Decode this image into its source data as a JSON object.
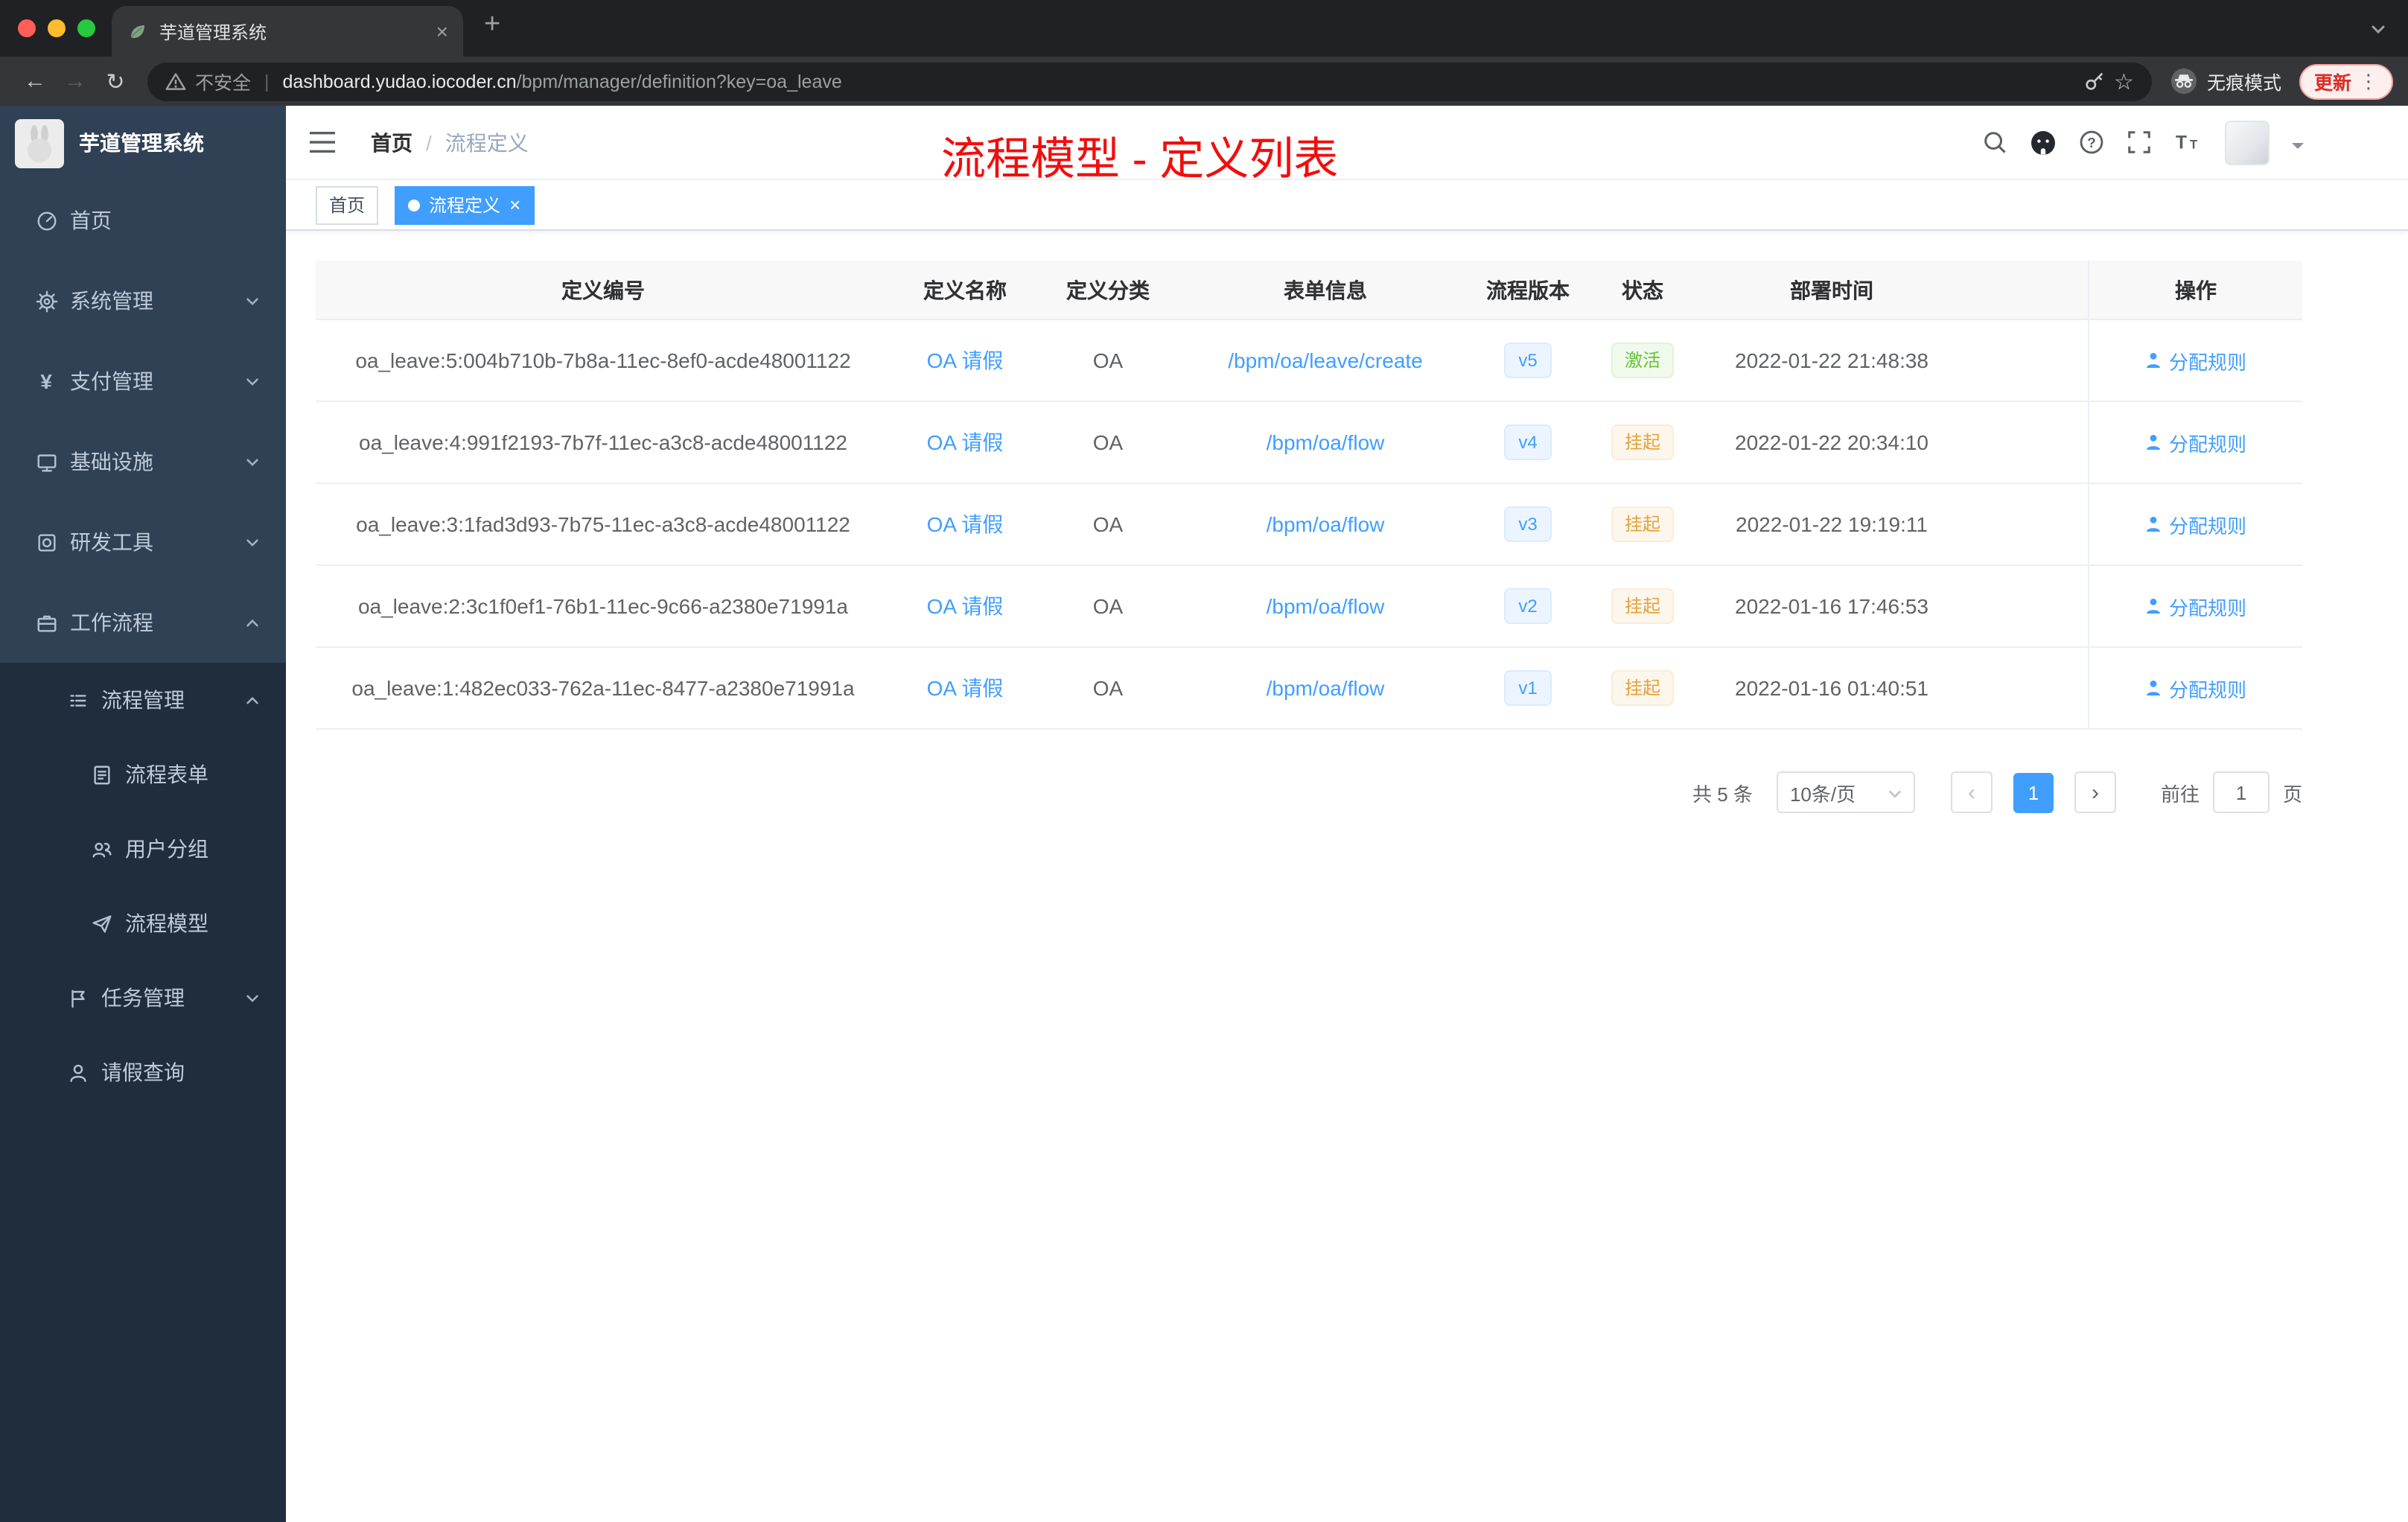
{
  "browser": {
    "tab_title": "芋道管理系统",
    "security_label": "不安全",
    "url_host": "dashboard.yudao.iocoder.cn",
    "url_path": "/bpm/manager/definition?key=oa_leave",
    "incognito_label": "无痕模式",
    "update_label": "更新"
  },
  "sidebar": {
    "logo_title": "芋道管理系统",
    "menu": [
      {
        "label": "首页",
        "icon": "dashboard-icon",
        "level": 1
      },
      {
        "label": "系统管理",
        "icon": "gear-icon",
        "level": 1,
        "chevron": "down"
      },
      {
        "label": "支付管理",
        "icon": "yen-icon",
        "level": 1,
        "chevron": "down"
      },
      {
        "label": "基础设施",
        "icon": "monitor-icon",
        "level": 1,
        "chevron": "down"
      },
      {
        "label": "研发工具",
        "icon": "toolbox-icon",
        "level": 1,
        "chevron": "down"
      },
      {
        "label": "工作流程",
        "icon": "briefcase-icon",
        "level": 1,
        "chevron": "up"
      },
      {
        "label": "流程管理",
        "icon": "list-tree-icon",
        "level": 2,
        "chevron": "up"
      },
      {
        "label": "流程表单",
        "icon": "document-icon",
        "level": 3
      },
      {
        "label": "用户分组",
        "icon": "user-group-icon",
        "level": 3
      },
      {
        "label": "流程模型",
        "icon": "paper-plane-icon",
        "level": 3
      },
      {
        "label": "任务管理",
        "icon": "task-icon",
        "level": 2,
        "chevron": "down"
      },
      {
        "label": "请假查询",
        "icon": "user-icon",
        "level": 2
      }
    ]
  },
  "header": {
    "breadcrumb_home": "首页",
    "breadcrumb_separator": "/",
    "breadcrumb_current": "流程定义",
    "annotation": "流程模型 - 定义列表"
  },
  "tags": [
    {
      "label": "首页",
      "active": false,
      "closable": false
    },
    {
      "label": "流程定义",
      "active": true,
      "closable": true
    }
  ],
  "table": {
    "columns": [
      "定义编号",
      "定义名称",
      "定义分类",
      "表单信息",
      "流程版本",
      "状态",
      "部署时间",
      "操作"
    ],
    "action_label": "分配规则",
    "rows": [
      {
        "id": "oa_leave:5:004b710b-7b8a-11ec-8ef0-acde48001122",
        "name": "OA 请假",
        "category": "OA",
        "form": "/bpm/oa/leave/create",
        "version": "v5",
        "status": "激活",
        "status_type": "success",
        "deploy_time": "2022-01-22 21:48:38"
      },
      {
        "id": "oa_leave:4:991f2193-7b7f-11ec-a3c8-acde48001122",
        "name": "OA 请假",
        "category": "OA",
        "form": "/bpm/oa/flow",
        "version": "v4",
        "status": "挂起",
        "status_type": "warning",
        "deploy_time": "2022-01-22 20:34:10"
      },
      {
        "id": "oa_leave:3:1fad3d93-7b75-11ec-a3c8-acde48001122",
        "name": "OA 请假",
        "category": "OA",
        "form": "/bpm/oa/flow",
        "version": "v3",
        "status": "挂起",
        "status_type": "warning",
        "deploy_time": "2022-01-22 19:19:11"
      },
      {
        "id": "oa_leave:2:3c1f0ef1-76b1-11ec-9c66-a2380e71991a",
        "name": "OA 请假",
        "category": "OA",
        "form": "/bpm/oa/flow",
        "version": "v2",
        "status": "挂起",
        "status_type": "warning",
        "deploy_time": "2022-01-16 17:46:53"
      },
      {
        "id": "oa_leave:1:482ec033-762a-11ec-8477-a2380e71991a",
        "name": "OA 请假",
        "category": "OA",
        "form": "/bpm/oa/flow",
        "version": "v1",
        "status": "挂起",
        "status_type": "warning",
        "deploy_time": "2022-01-16 01:40:51"
      }
    ]
  },
  "pagination": {
    "total": "共 5 条",
    "page_size": "10条/页",
    "current_page": "1",
    "goto": "前往",
    "goto_value": "1",
    "unit": "页"
  },
  "colors": {
    "accent": "#409eff",
    "annotation_red": "#f20d0d",
    "status_active_green": "#67c23a",
    "status_suspended_orange": "#e6a23c",
    "sidebar_bg": "#304156",
    "submenu_bg": "#1f2d3d"
  }
}
